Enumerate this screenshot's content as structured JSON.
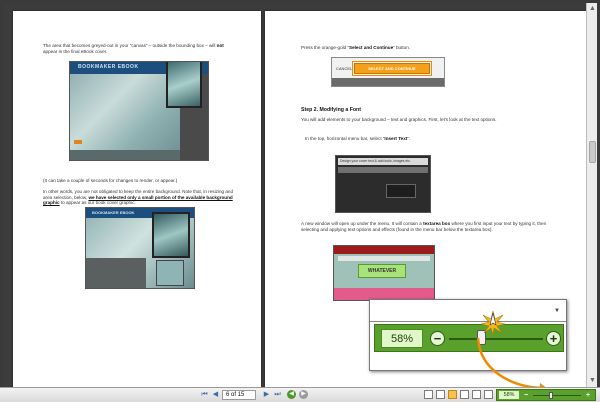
{
  "left_page": {
    "p1": "The area that becomes greyed-out in your “canvas” – outside the bounding box – will",
    "p1_bold": "not",
    "p1_end": "appear in the final eBook cover.",
    "shot1_logo": "BOOKMAKER EBOOK",
    "p2": "(It can take a couple of seconds for changes to render, or appear.)",
    "p3": "In other words, you are not obligated to keep the entire background. Note that, in resizing and area selection, below,",
    "p3_link": "we have selected only a small portion of the available background graphic",
    "p3_end": "to appear as our book cover graphic:",
    "shot2_logo": "BOOKMAKER EBOOK"
  },
  "right_page": {
    "p1_start": "Press the orange-gold “",
    "p1_bold": "Select and Continue",
    "p1_end": "” button.",
    "shot1_cancel": "CANCEL",
    "shot1_button": "SELECT AND CONTINUE",
    "step2": "Step 2. Modifying a Font",
    "p2": "You will add elements to your background – text and graphics. First, let's look at the text options.",
    "p3_start": "In the top, horizontal menu bar, select “",
    "p3_bold": "Insert Text",
    "p3_end": "”:",
    "shot2_top": "Design your cover text & add tools, images etc.",
    "p4_start": "A new window will open up under the menu. It will contain a",
    "p4_bold": "textarea box",
    "p4_end": "where you first input your text by typing it, then selecting and applying text options and effects (found in the menu bar below the textarea box).",
    "shot3_text": "WHATEVER"
  },
  "zoom_callout": {
    "percent": "58%",
    "minus": "−",
    "plus": "+",
    "dropdown": "▼",
    "level": 0.58
  },
  "toolbar": {
    "first": "⏮",
    "prev": "◀",
    "page_value": "6 of 15",
    "next": "▶",
    "last": "⏭",
    "back": "◀",
    "forward": "▶",
    "zoom_percent": "58%",
    "zoom_minus": "−",
    "zoom_plus": "+"
  },
  "colors": {
    "zoom_green": "#5aa02c",
    "highlight_orange": "#f08a00",
    "button_orange": "#f4a01b"
  }
}
